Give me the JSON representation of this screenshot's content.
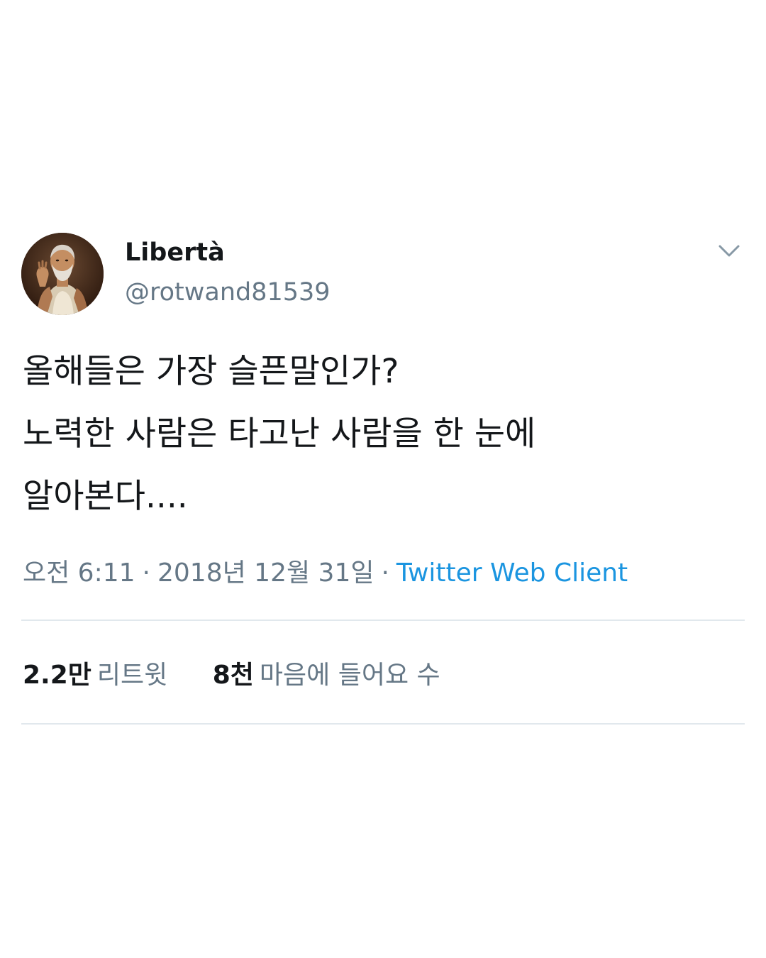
{
  "tweet": {
    "author": {
      "display_name": "Libertà",
      "handle": "@rotwand81539",
      "avatar_icon": "profile-portrait"
    },
    "menu_icon": "chevron-down-icon",
    "text_lines": [
      "올해들은 가장 슬픈말인가?",
      "노력한 사람은 타고난 사람을 한 눈에",
      "알아본다...."
    ],
    "meta": {
      "time": "오전 6:11",
      "separator_1": "·",
      "date": "2018년 12월 31일",
      "separator_2": "·",
      "client": "Twitter Web Client"
    },
    "stats": {
      "retweets_count": "2.2만",
      "retweets_label": "리트윗",
      "likes_count": "8천",
      "likes_label": "마음에 들어요 수"
    }
  },
  "colors": {
    "text_primary": "#14171a",
    "text_secondary": "#657786",
    "link": "#1b95e0",
    "divider": "#e1e8ed",
    "background": "#ffffff"
  }
}
